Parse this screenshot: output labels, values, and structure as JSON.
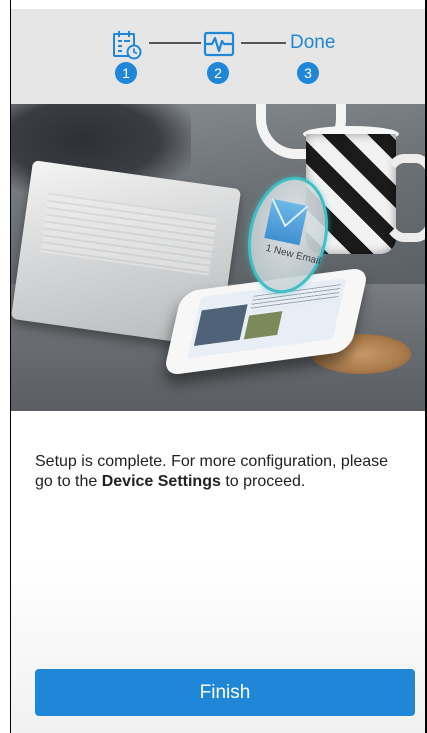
{
  "stepper": {
    "steps": [
      {
        "number": "1",
        "icon": "calendar-clock-icon"
      },
      {
        "number": "2",
        "icon": "heartbeat-monitor-icon"
      },
      {
        "number": "3",
        "label": "Done"
      }
    ],
    "active_color": "#1f86d8",
    "background": "#e6e6e6"
  },
  "hero": {
    "bubble_text": "1 New Email"
  },
  "message": {
    "text_before": "Setup is complete. For more configuration, please go to the ",
    "bold": "Device Settings",
    "text_after": " to proceed."
  },
  "finish_button": {
    "label": "Finish",
    "color": "#1f86d8"
  }
}
